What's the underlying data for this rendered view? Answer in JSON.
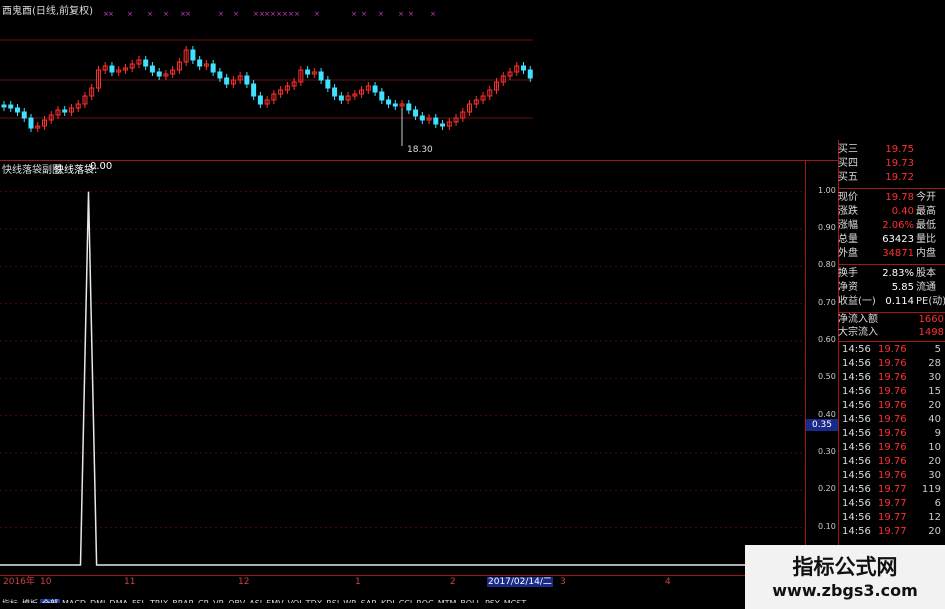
{
  "top_chart": {
    "title": "酉鬼酉(日线,前复权)",
    "low_marker": "18.30"
  },
  "lower_chart": {
    "title": "快线落袋副图",
    "indicator_name": "快线落袋:",
    "indicator_value": "0.00",
    "y_ticks": [
      "1.00",
      "0.90",
      "0.80",
      "0.70",
      "0.60",
      "0.50",
      "0.40",
      "0.30",
      "0.20",
      "0.10"
    ],
    "current_value_box": "0.35"
  },
  "chart_data": {
    "type": "line",
    "title": "快线落袋副图",
    "ylim": [
      0.0,
      1.05
    ],
    "description_series": [
      {
        "name": "快线落袋",
        "x": [
          0,
          10,
          11,
          12,
          13,
          100
        ],
        "values": [
          0,
          0,
          1.0,
          0,
          0,
          0
        ]
      }
    ]
  },
  "quote_panel": {
    "order_book": [
      {
        "label": "买三",
        "value": "19.75"
      },
      {
        "label": "买四",
        "value": "19.73"
      },
      {
        "label": "买五",
        "value": "19.72"
      }
    ],
    "stats": [
      {
        "label": "现价",
        "value": "19.78",
        "label2": "今开",
        "color": "#ff3030"
      },
      {
        "label": "涨跌",
        "value": "0.40",
        "label2": "最高",
        "color": "#ff3030"
      },
      {
        "label": "涨幅",
        "value": "2.06%",
        "label2": "最低",
        "color": "#ff3030"
      },
      {
        "label": "总量",
        "value": "63423",
        "label2": "量比",
        "color": "#ffffff"
      },
      {
        "label": "外盘",
        "value": "34871",
        "label2": "内盘",
        "color": "#ff3030"
      }
    ],
    "stats2": [
      {
        "label": "换手",
        "value": "2.83%",
        "label2": "股本",
        "color": "#ffffff"
      },
      {
        "label": "净资",
        "value": "5.85",
        "label2": "流通",
        "color": "#ffffff"
      },
      {
        "label": "收益(一)",
        "value": "0.114",
        "label2": "PE(动)",
        "color": "#ffffff"
      }
    ],
    "flows": [
      {
        "label": "净流入额",
        "value": "1660"
      },
      {
        "label": "大宗流入",
        "value": "1498"
      }
    ],
    "ticks": [
      {
        "time": "14:56",
        "price": "19.76",
        "vol": "5"
      },
      {
        "time": "14:56",
        "price": "19.76",
        "vol": "28"
      },
      {
        "time": "14:56",
        "price": "19.76",
        "vol": "30"
      },
      {
        "time": "14:56",
        "price": "19.76",
        "vol": "15"
      },
      {
        "time": "14:56",
        "price": "19.76",
        "vol": "20"
      },
      {
        "time": "14:56",
        "price": "19.76",
        "vol": "40"
      },
      {
        "time": "14:56",
        "price": "19.76",
        "vol": "9"
      },
      {
        "time": "14:56",
        "price": "19.76",
        "vol": "10"
      },
      {
        "time": "14:56",
        "price": "19.76",
        "vol": "20"
      },
      {
        "time": "14:56",
        "price": "19.76",
        "vol": "30"
      },
      {
        "time": "14:56",
        "price": "19.77",
        "vol": "119"
      },
      {
        "time": "14:56",
        "price": "19.77",
        "vol": "6"
      },
      {
        "time": "14:56",
        "price": "19.77",
        "vol": "12"
      },
      {
        "time": "14:56",
        "price": "19.77",
        "vol": "20"
      }
    ]
  },
  "date_axis": {
    "labels": [
      "2016年",
      "10",
      "11",
      "12",
      "1",
      "2",
      "3",
      "4"
    ],
    "current": "2017/02/14/二"
  },
  "tabs": [
    "指标",
    "模板",
    "全部",
    "MACD",
    "DMI",
    "DMA",
    "FSL",
    "TRIX",
    "BRAR",
    "CR",
    "VR",
    "OBV",
    "ASI",
    "EMV",
    "VOL-TDX",
    "RSI",
    "WR",
    "SAR",
    "KDJ",
    "CCI",
    "ROC",
    "MTM",
    "BOLL",
    "PSY",
    "MCST"
  ],
  "active_tab": "全部",
  "watermark": {
    "title": "指标公式网",
    "url": "www.zbgs3.com"
  }
}
